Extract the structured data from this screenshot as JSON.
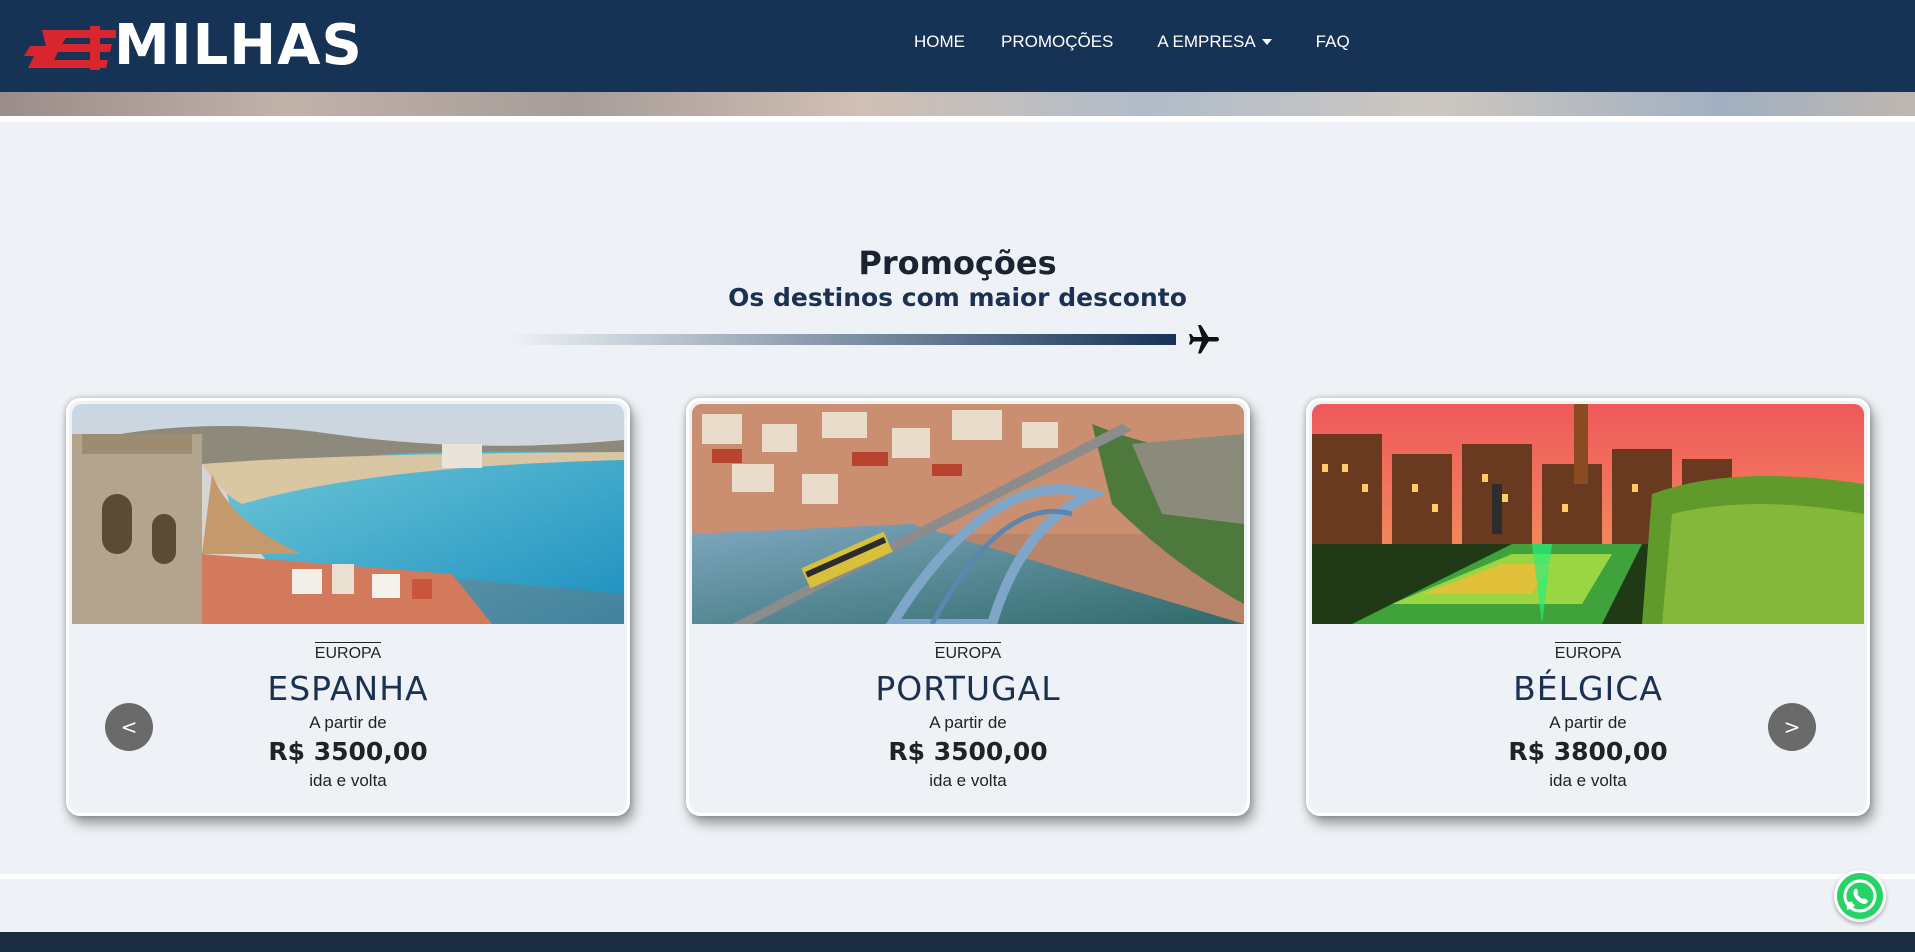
{
  "brand": {
    "logo_text": "MILHAS"
  },
  "nav": {
    "items": [
      {
        "label": "HOME"
      },
      {
        "label": "PROMOÇÕES"
      },
      {
        "label": "A EMPRESA"
      },
      {
        "label": "FAQ"
      }
    ]
  },
  "section": {
    "title": "Promoções",
    "subtitle": "Os destinos com maior desconto"
  },
  "cards": [
    {
      "region": "EUROPA",
      "country": "ESPANHA",
      "from_label": "A partir de",
      "price": "R$ 3500,00",
      "trip": "ida e volta"
    },
    {
      "region": "EUROPA",
      "country": "PORTUGAL",
      "from_label": "A partir de",
      "price": "R$ 3500,00",
      "trip": "ida e volta"
    },
    {
      "region": "EUROPA",
      "country": "BÉLGICA",
      "from_label": "A partir de",
      "price": "R$ 3800,00",
      "trip": "ida e volta"
    }
  ],
  "carousel": {
    "prev_label": "<",
    "next_label": ">"
  },
  "colors": {
    "navbar": "#163356",
    "accent_red": "#d9262e",
    "whatsapp": "#25d366"
  }
}
